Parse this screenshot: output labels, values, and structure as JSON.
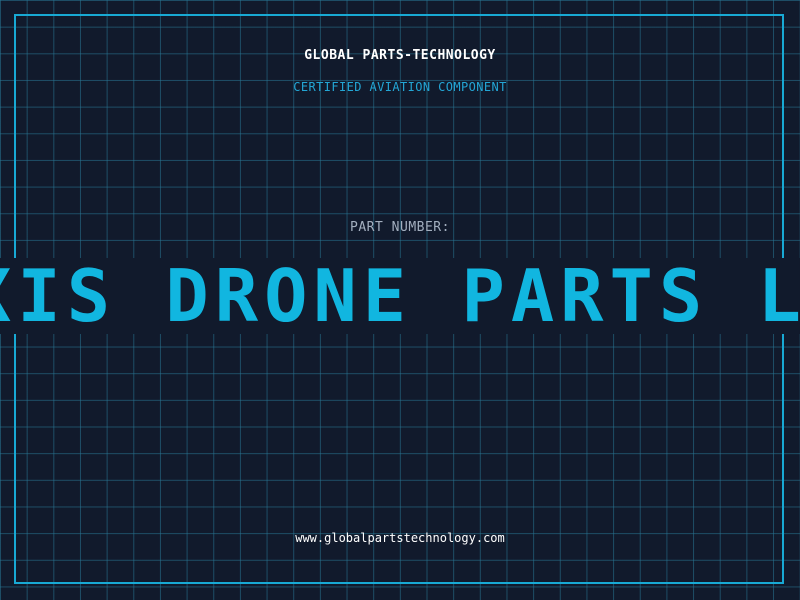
{
  "header": {
    "company": "GLOBAL PARTS-TECHNOLOGY",
    "subtitle": "CERTIFIED AVIATION COMPONENT"
  },
  "part": {
    "label": "PART NUMBER:",
    "value": "XIS DRONE PARTS LOG"
  },
  "footer": {
    "url": "www.globalpartstechnology.com"
  },
  "colors": {
    "background": "#111a2c",
    "grid": "#1f5f78",
    "accent": "#18a9d4",
    "text_primary": "#ffffff",
    "text_muted": "#a3afbf"
  }
}
